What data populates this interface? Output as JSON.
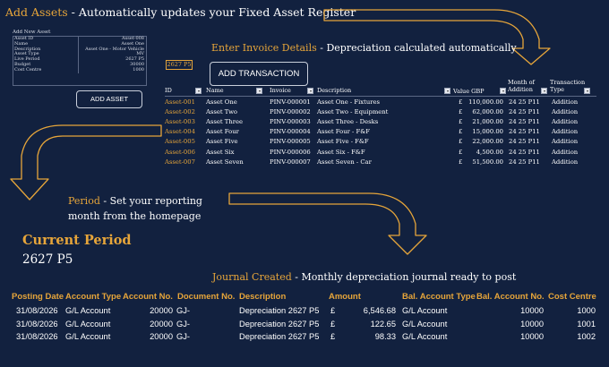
{
  "header": {
    "title_gold": "Add Assets",
    "title_rest": " - Automatically updates your Fixed Asset Register"
  },
  "asset_form": {
    "title": "Add New Asset",
    "fields": [
      {
        "label": "Asset ID",
        "value": "Asset-008"
      },
      {
        "label": "Name",
        "value": "Asset One"
      },
      {
        "label": "Description",
        "value": "Asset One - Motor Vehicle"
      },
      {
        "label": "Asset Type",
        "value": "MV"
      },
      {
        "label": "Live Period",
        "value": "2627 P5"
      },
      {
        "label": "Budget",
        "value": "30000"
      },
      {
        "label": "Cost Centre",
        "value": "1000"
      }
    ],
    "add_button": "ADD ASSET"
  },
  "invoice": {
    "heading_gold": "Enter Invoice Details",
    "heading_rest": " - Depreciation calculated automatically",
    "period_cell": "2627 P5",
    "add_button": "ADD TRANSACTION",
    "columns": [
      "ID",
      "Name",
      "Invoice",
      "Description",
      "Value GBP",
      "Month of Addition",
      "Transaction Type"
    ],
    "rows": [
      {
        "id": "Asset-001",
        "name": "Asset One",
        "invoice": "PINV-000001",
        "description": "Asset One - Fixtures",
        "currency": "£",
        "value": "110,000.00",
        "month": "24 25 P11",
        "type": "Addition"
      },
      {
        "id": "Asset-002",
        "name": "Asset Two",
        "invoice": "PINV-000002",
        "description": "Asset Two - Equipment",
        "currency": "£",
        "value": "62,000.00",
        "month": "24 25 P11",
        "type": "Addition"
      },
      {
        "id": "Asset-003",
        "name": "Asset Three",
        "invoice": "PINV-000003",
        "description": "Asset Three - Desks",
        "currency": "£",
        "value": "21,000.00",
        "month": "24 25 P11",
        "type": "Addition"
      },
      {
        "id": "Asset-004",
        "name": "Asset Four",
        "invoice": "PINV-000004",
        "description": "Asset Four - F&F",
        "currency": "£",
        "value": "15,000.00",
        "month": "24 25 P11",
        "type": "Addition"
      },
      {
        "id": "Asset-005",
        "name": "Asset Five",
        "invoice": "PINV-000005",
        "description": "Asset Five - F&F",
        "currency": "£",
        "value": "22,000.00",
        "month": "24 25 P11",
        "type": "Addition"
      },
      {
        "id": "Asset-006",
        "name": "Asset Six",
        "invoice": "PINV-000006",
        "description": "Asset Six - F&F",
        "currency": "£",
        "value": "4,500.00",
        "month": "24 25 P11",
        "type": "Addition"
      },
      {
        "id": "Asset-007",
        "name": "Asset Seven",
        "invoice": "PINV-000007",
        "description": "Asset Seven - Car",
        "currency": "£",
        "value": "51,500.00",
        "month": "24 25 P11",
        "type": "Addition"
      }
    ]
  },
  "period": {
    "heading_gold": "Period",
    "heading_rest": " - Set your reporting",
    "line2": "month from the homepage",
    "current_label": "Current Period",
    "current_value": "2627 P5"
  },
  "journal": {
    "heading_gold": "Journal Created",
    "heading_rest": " - Monthly depreciation journal ready to post",
    "columns": [
      "Posting Date",
      "Account Type",
      "Account No.",
      "Document No.",
      "Description",
      "Amount",
      "Bal. Account Type",
      "Bal. Account No.",
      "Cost Centre"
    ],
    "rows": [
      {
        "date": "31/08/2026",
        "acct_type": "G/L Account",
        "acct_no": "20000",
        "doc": "GJ-",
        "desc": "Depreciation 2627 P5",
        "cur": "£",
        "amount": "6,546.68",
        "bal_type": "G/L Account",
        "bal_no": "10000",
        "cc": "1000"
      },
      {
        "date": "31/08/2026",
        "acct_type": "G/L Account",
        "acct_no": "20000",
        "doc": "GJ-",
        "desc": "Depreciation 2627 P5",
        "cur": "£",
        "amount": "122.65",
        "bal_type": "G/L Account",
        "bal_no": "10000",
        "cc": "1001"
      },
      {
        "date": "31/08/2026",
        "acct_type": "G/L Account",
        "acct_no": "20000",
        "doc": "GJ-",
        "desc": "Depreciation 2627 P5",
        "cur": "£",
        "amount": "98.33",
        "bal_type": "G/L Account",
        "bal_no": "10000",
        "cc": "1002"
      }
    ]
  },
  "colors": {
    "background": "#12213f",
    "accent_gold": "#e6a53a",
    "text": "#ffffff"
  },
  "icons": [
    "arrow-right-down-icon",
    "arrow-left-down-icon",
    "filter-dropdown-icon"
  ]
}
